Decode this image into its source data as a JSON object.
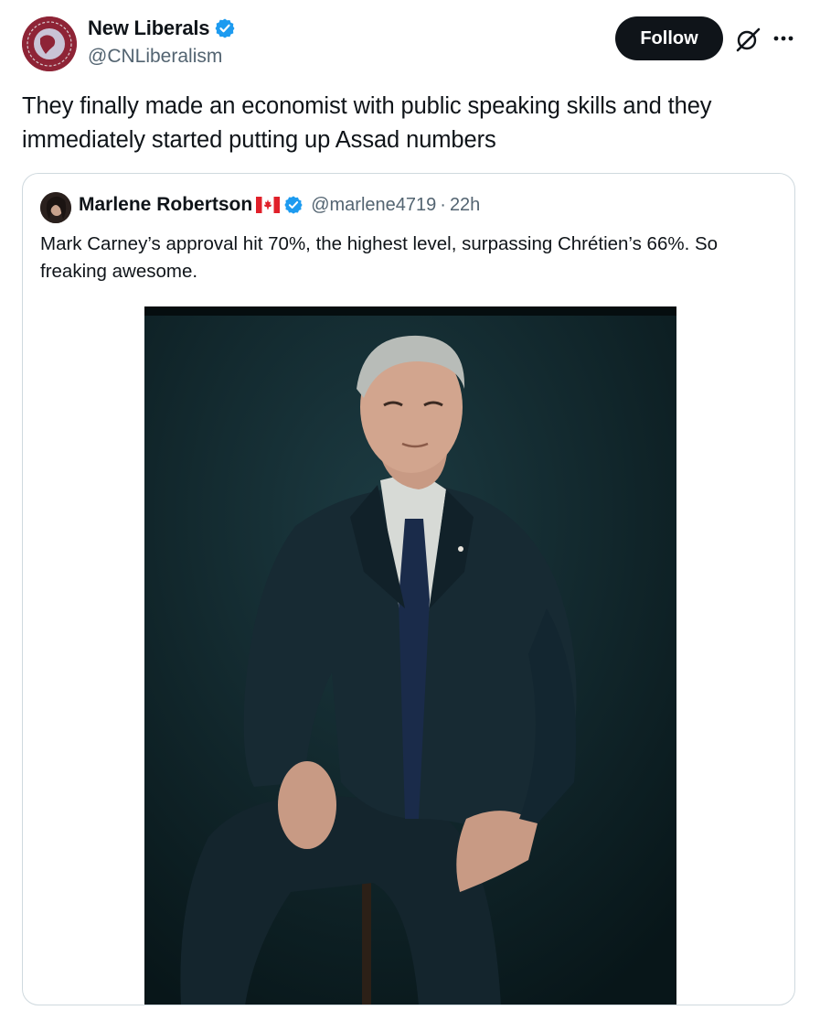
{
  "author": {
    "display_name": "New Liberals",
    "handle": "@CNLiberalism",
    "verified_icon": "verified-badge-icon",
    "avatar_icon": "new-liberals-logo"
  },
  "actions": {
    "follow_label": "Follow",
    "grok_icon": "grok-icon",
    "more_icon": "more-options-icon"
  },
  "post": {
    "text": "They finally made an economist with public speaking skills and they immediately started putting up Assad numbers"
  },
  "quote": {
    "display_name": "Marlene Robertson",
    "flag_icon": "canada-flag-icon",
    "handle": "@marlene4719",
    "separator": "·",
    "time": "22h",
    "text": "Mark Carney’s approval hit 70%, the highest level, surpassing Chrétien’s 66%. So freaking awesome."
  },
  "colors": {
    "verified_blue": "#1d9bf0",
    "follow_bg": "#0f1419",
    "secondary_text": "#536471",
    "border": "#cfd9de",
    "photo_bg": "#0c1d22"
  }
}
